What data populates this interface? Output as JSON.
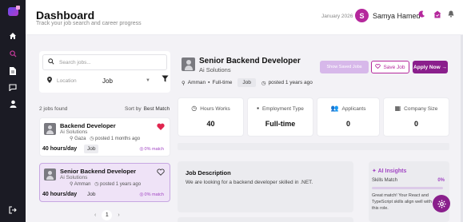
{
  "header": {
    "title": "Dashboard",
    "subtitle": "Track your job search and career progress",
    "date": "January 2026",
    "avatar_letter": "S",
    "user_name": "Samya Hamed"
  },
  "sidebar": {
    "items": [
      {
        "icon": "home-icon"
      },
      {
        "icon": "search-icon"
      },
      {
        "icon": "document-icon"
      },
      {
        "icon": "chat-icon"
      },
      {
        "icon": "person-icon"
      },
      {
        "icon": "logout-icon"
      }
    ]
  },
  "search": {
    "placeholder": "Search jobs...",
    "location_placeholder": "Location",
    "job_type": "Job"
  },
  "list": {
    "jobs_found": "2 jobs found",
    "sort_label": "Sort by",
    "sort_value": "Best Match"
  },
  "jobs": [
    {
      "title": "Backend Developer",
      "company": "Ai Solutions",
      "location": "Gaza",
      "posted": "posted 1 months ago",
      "hours": "40 hours/day",
      "tag": "Job",
      "match": "0% match",
      "favorited": true
    },
    {
      "title": "Senior Backend Developer",
      "company": "Ai Solutions",
      "location": "Amman",
      "posted": "posted 1 years ago",
      "hours": "40 hours/day",
      "tag": "Job",
      "match": "0% match",
      "favorited": false
    }
  ],
  "pagination": {
    "current": "1"
  },
  "detail": {
    "title": "Senior Backend Developer",
    "company": "Ai Solutions",
    "location": "Amman",
    "schedule": "Full-time",
    "tag": "Job",
    "posted": "posted 1 years ago",
    "btn_saved": "Show Saved Jobs",
    "btn_save": "Save Job",
    "btn_apply": "Apply Now →"
  },
  "stats": [
    {
      "label": "Hours Works",
      "value": "40",
      "icon": "clock-icon"
    },
    {
      "label": "Employment Type",
      "value": "Full-time",
      "icon": "briefcase-icon"
    },
    {
      "label": "Applicants",
      "value": "0",
      "icon": "people-icon"
    },
    {
      "label": "Company Size",
      "value": "0",
      "icon": "building-icon"
    }
  ],
  "description": {
    "title": "Job Description",
    "text": "We are looking for a backend developer skilled in .NET."
  },
  "insights": {
    "title": "AI Insights",
    "skills_label": "Skills Match",
    "skills_pct": "0%",
    "skills_value": 0,
    "text": "Great match! Your React and TypeScript skills align well with this role."
  },
  "colors": {
    "accent": "#b5289c",
    "primary": "#8a1f8c",
    "sidebar_bg": "#1b1b24",
    "match": "#a246c4"
  }
}
